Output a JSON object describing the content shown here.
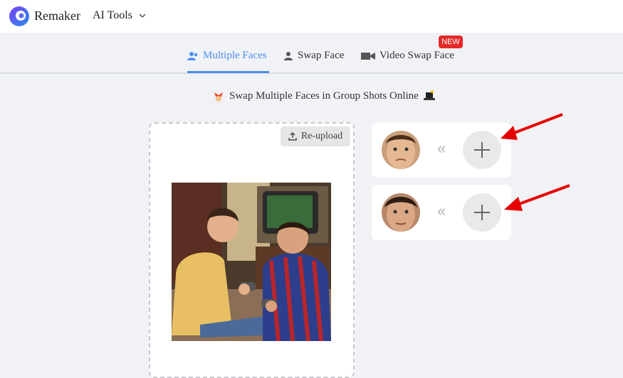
{
  "header": {
    "brand": "Remaker",
    "menu_label": "AI Tools"
  },
  "tabs": [
    {
      "label": "Multiple Faces",
      "active": true,
      "icon": "users-icon"
    },
    {
      "label": "Swap Face",
      "active": false,
      "icon": "user-icon"
    },
    {
      "label": "Video Swap Face",
      "active": false,
      "icon": "video-icon"
    }
  ],
  "badge": {
    "new": "NEW"
  },
  "main": {
    "subtitle": "Swap Multiple Faces in Group Shots Online",
    "reupload_label": "Re-upload",
    "face_separator": "«"
  },
  "colors": {
    "accent": "#4b8ef2",
    "badge": "#e62a2a",
    "annotation": "#e60000"
  }
}
